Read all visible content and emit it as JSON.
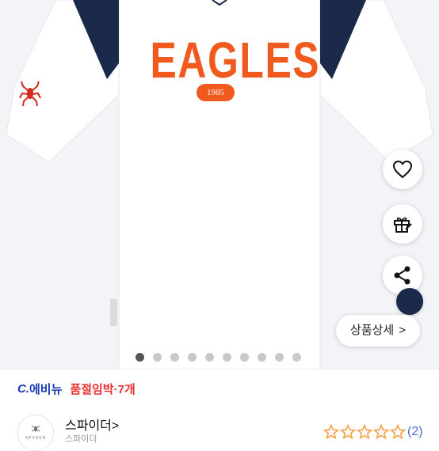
{
  "product": {
    "wordmark": "EAGLES",
    "year": "1985"
  },
  "floating_actions": {
    "detail_label": "상품상세",
    "detail_chevron": ">"
  },
  "carousel": {
    "total": 10,
    "active_index": 0
  },
  "promo": {
    "brand_mark": "C.",
    "brand_name": "에비뉴",
    "stock_text": "품절임박·7개"
  },
  "shop": {
    "name": "스파이더",
    "name_chevron": ">",
    "logo_text": "SPYDER",
    "sub_text": "스파이더",
    "rating_stars": 5,
    "review_count": "(2)"
  },
  "colors": {
    "accent_orange": "#f05a1e",
    "navy": "#1b2a4a",
    "brand_blue": "#1a3bb5",
    "soldout_red": "#e8312f",
    "star_orange": "#f5a14a",
    "review_blue": "#4b6fd0"
  },
  "icons": [
    "heart-icon",
    "gift-icon",
    "share-icon",
    "spider-logo-icon",
    "star-icon"
  ]
}
